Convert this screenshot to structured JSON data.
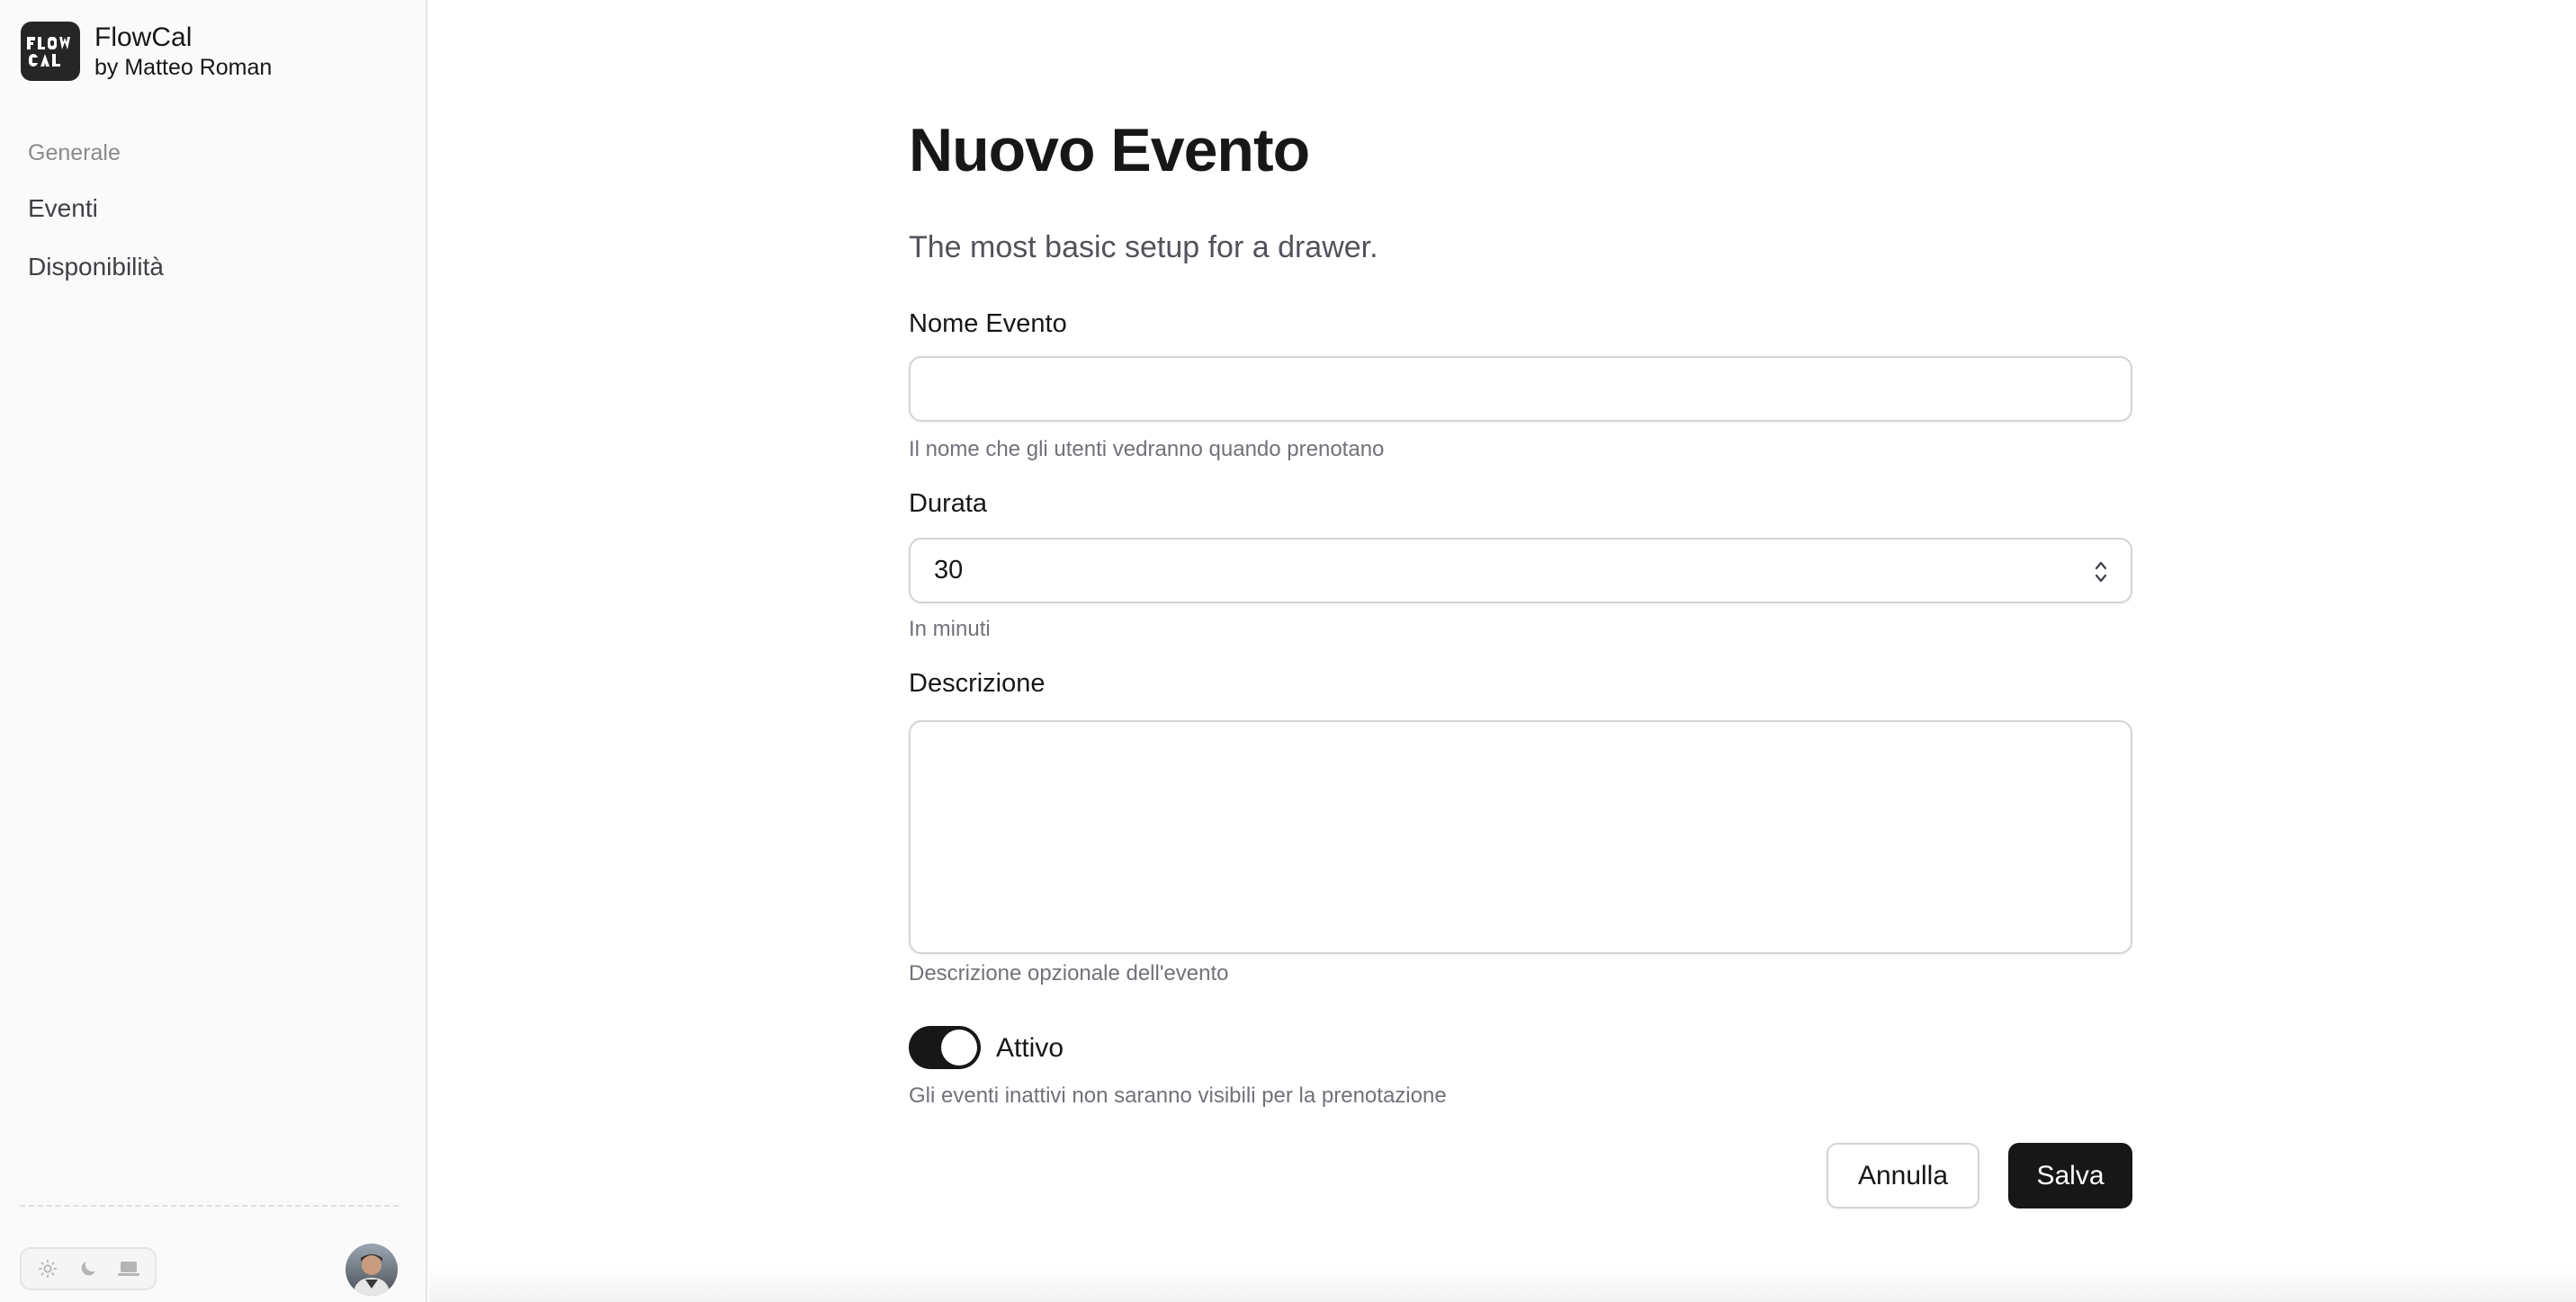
{
  "app": {
    "name": "FlowCal",
    "byline": "by Matteo Roman",
    "logo_text": "FLOW CAL"
  },
  "sidebar": {
    "group_label": "Generale",
    "items": [
      {
        "label": "Eventi"
      },
      {
        "label": "Disponibilità"
      }
    ],
    "theme_options": [
      {
        "icon": "sun-icon",
        "label": "light"
      },
      {
        "icon": "moon-icon",
        "label": "dark"
      },
      {
        "icon": "laptop-icon",
        "label": "system"
      }
    ],
    "avatar": {
      "icon": "user-avatar"
    }
  },
  "form": {
    "title": "Nuovo Evento",
    "description": "The most basic setup for a drawer.",
    "name_field": {
      "label": "Nome Evento",
      "value": "",
      "hint": "Il nome che gli utenti vedranno quando prenotano"
    },
    "duration_field": {
      "label": "Durata",
      "value": "30",
      "hint": "In minuti"
    },
    "description_field": {
      "label": "Descrizione",
      "value": "",
      "hint": "Descrizione opzionale dell'evento"
    },
    "active_toggle": {
      "label": "Attivo",
      "checked": true,
      "hint": "Gli eventi inattivi non saranno visibili per la prenotazione"
    },
    "cancel_label": "Annulla",
    "save_label": "Salva"
  },
  "colors": {
    "primary": "#171717",
    "sidebar_bg": "#fafafa",
    "muted_text": "#71717a",
    "border": "#d4d4d8"
  }
}
